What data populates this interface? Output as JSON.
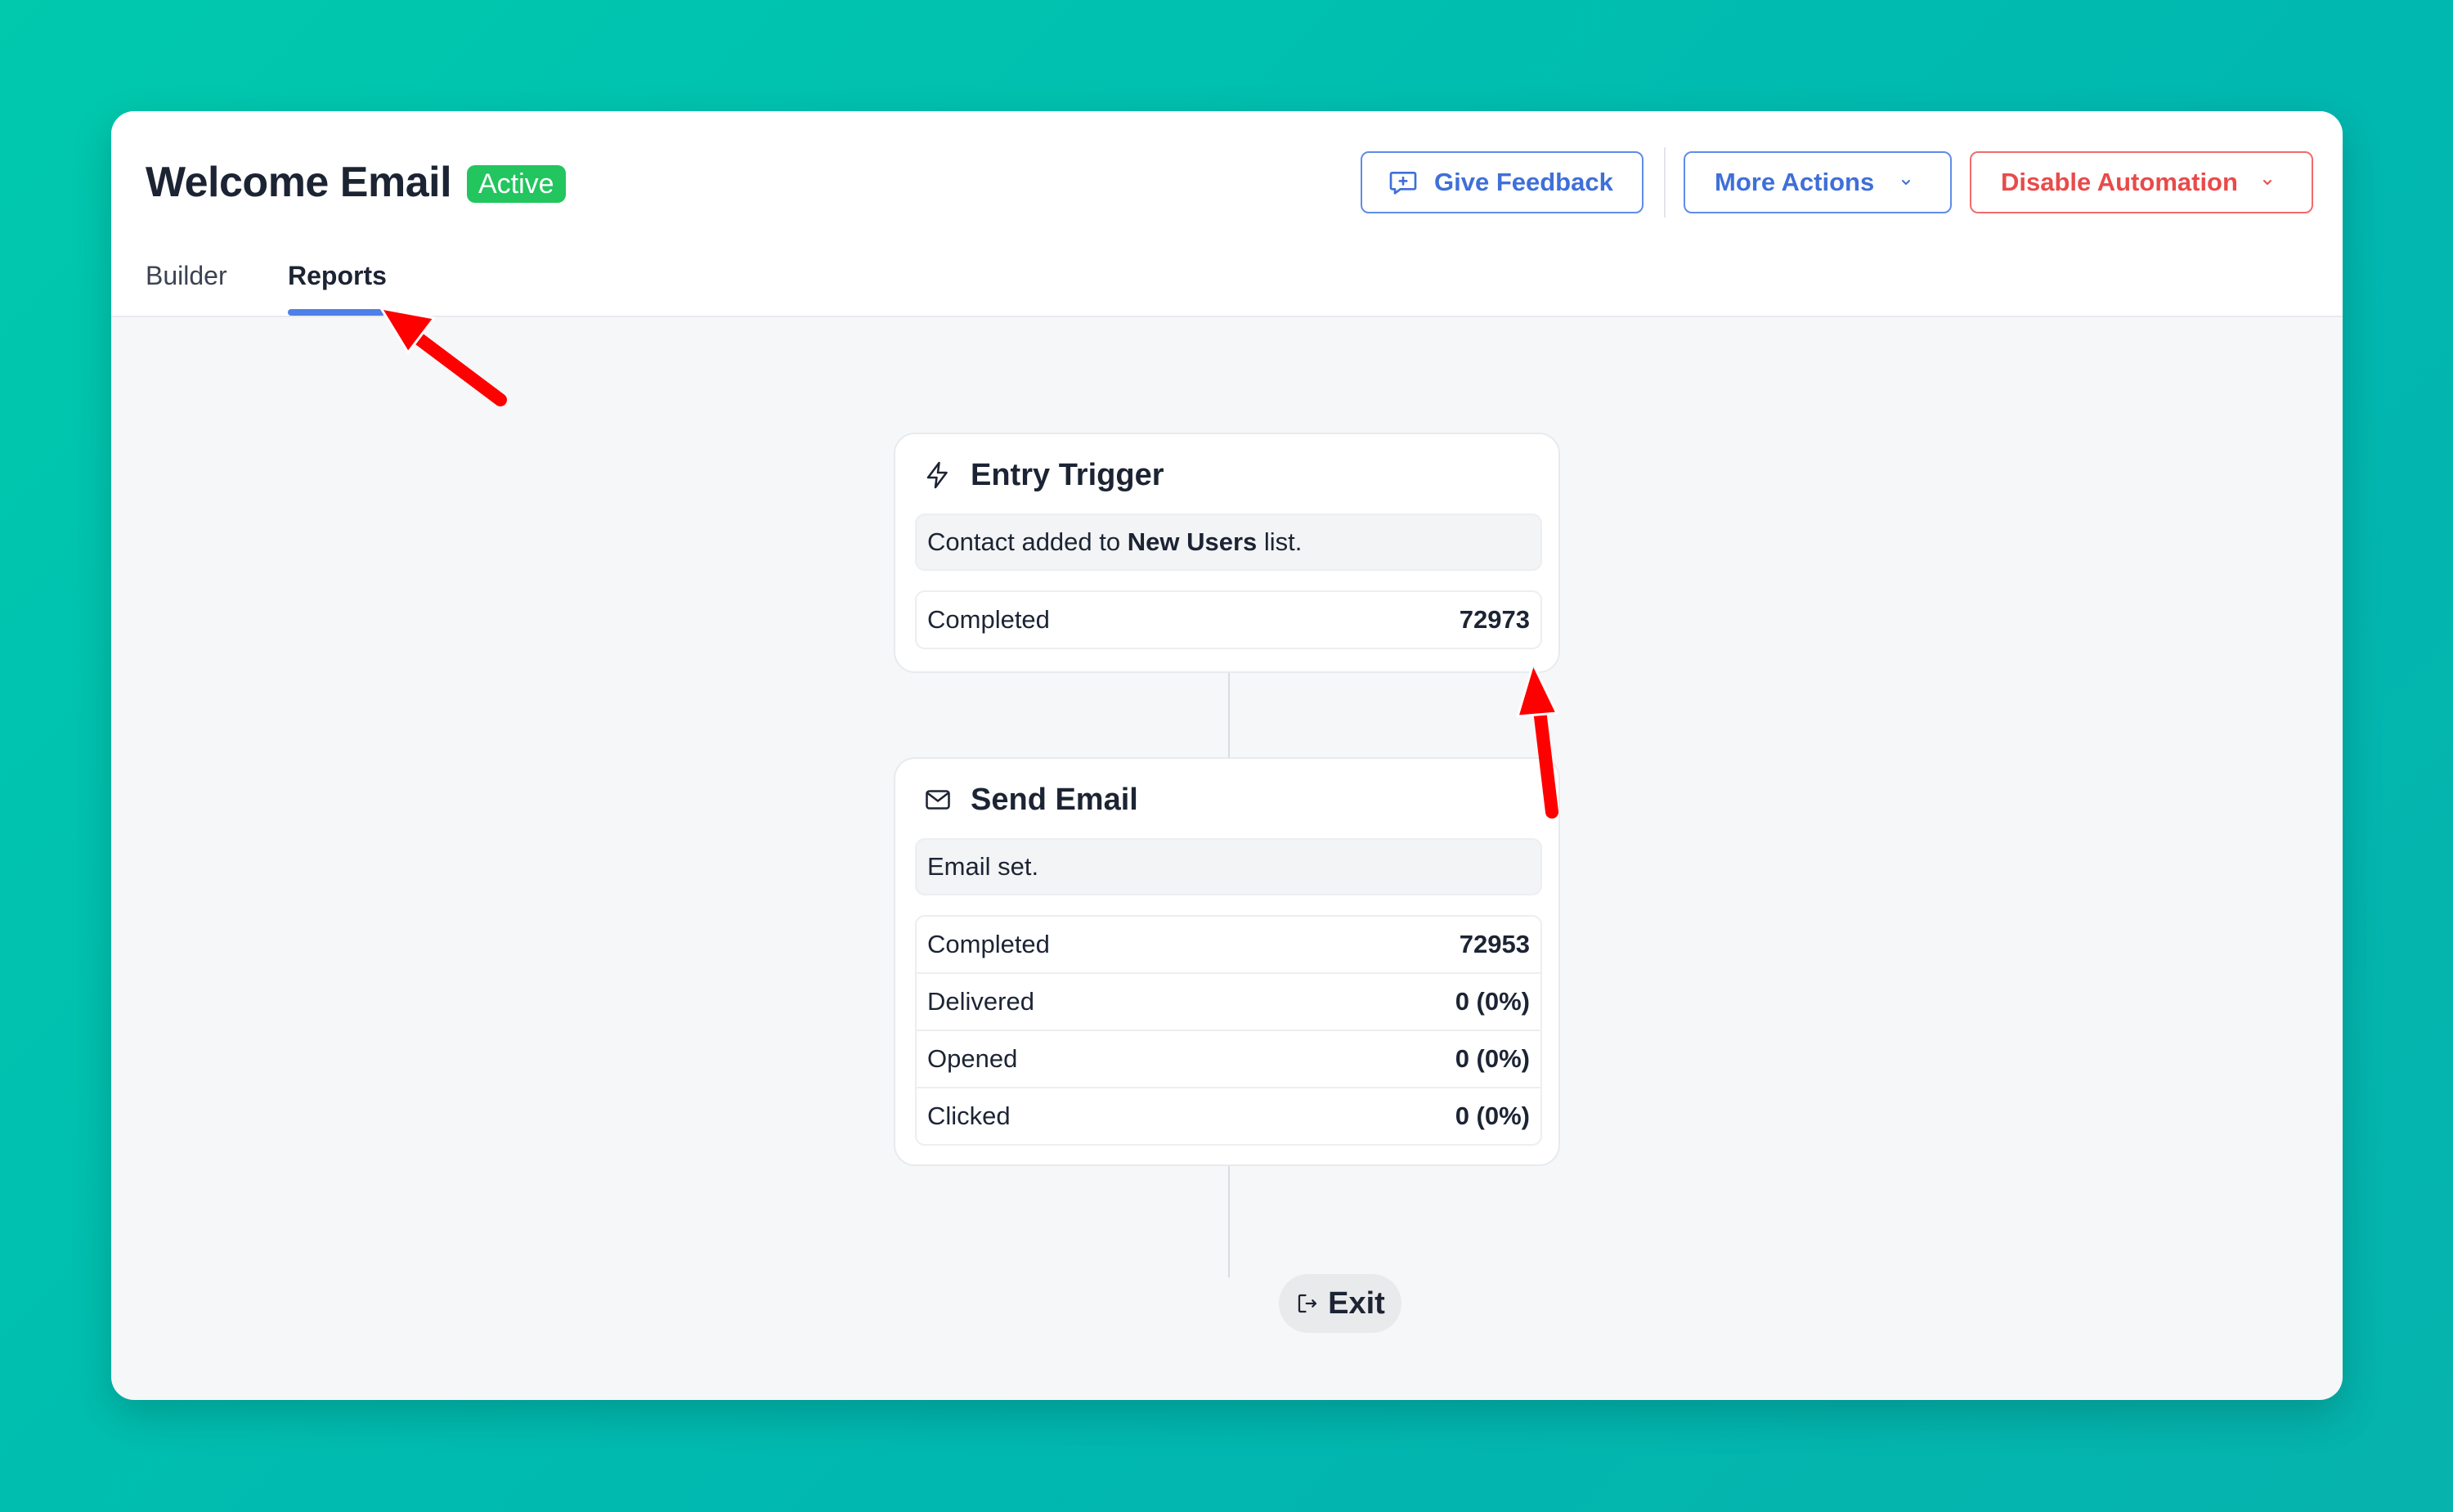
{
  "header": {
    "title": "Welcome Email",
    "status_badge": "Active",
    "tabs": [
      {
        "label": "Builder",
        "active": false
      },
      {
        "label": "Reports",
        "active": true
      }
    ],
    "actions": {
      "feedback_label": "Give Feedback",
      "more_actions_label": "More Actions",
      "disable_label": "Disable Automation"
    }
  },
  "flow": {
    "entry_trigger": {
      "title": "Entry Trigger",
      "icon": "lightning-icon",
      "description_prefix": "Contact added to ",
      "description_list": "New Users",
      "description_suffix": " list.",
      "stats": [
        {
          "label": "Completed",
          "value": "72973"
        }
      ]
    },
    "send_email": {
      "title": "Send Email",
      "icon": "envelope-icon",
      "description": "Email set.",
      "stats": [
        {
          "label": "Completed",
          "value": "72953"
        },
        {
          "label": "Delivered",
          "value": "0 (0%)"
        },
        {
          "label": "Opened",
          "value": "0 (0%)"
        },
        {
          "label": "Clicked",
          "value": "0 (0%)"
        }
      ]
    },
    "exit_label": "Exit"
  },
  "colors": {
    "accent": "#3f6fd8",
    "danger": "#e94a4a",
    "badge_green": "#22c55e",
    "annotation_arrow": "#ff0000"
  }
}
